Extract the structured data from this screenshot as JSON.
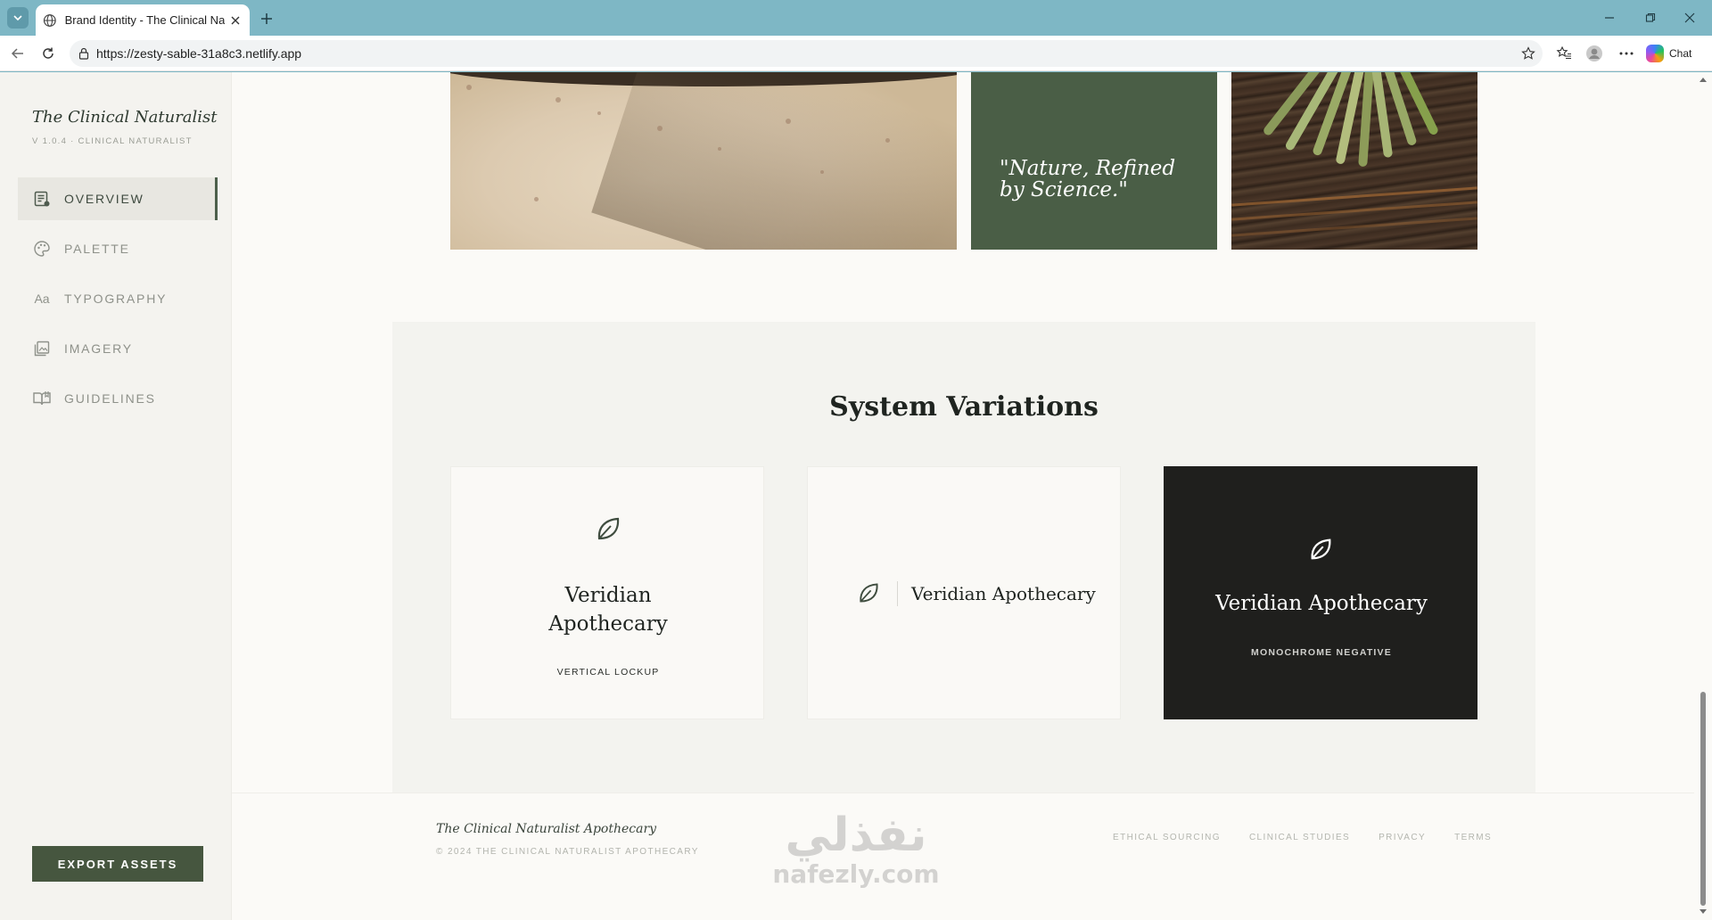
{
  "browser": {
    "tab_title": "Brand Identity - The Clinical Naturalist",
    "url": "https://zesty-sable-31a8c3.netlify.app",
    "chat_label": "Chat"
  },
  "sidebar": {
    "brand_title": "The Clinical Naturalist",
    "version": "V 1.0.4 · CLINICAL NATURALIST",
    "nav": [
      {
        "label": "OVERVIEW",
        "icon": "overview-icon",
        "active": true
      },
      {
        "label": "PALETTE",
        "icon": "palette-icon",
        "active": false
      },
      {
        "label": "TYPOGRAPHY",
        "icon": "typography-icon",
        "glyph": "Aa",
        "active": false
      },
      {
        "label": "IMAGERY",
        "icon": "imagery-icon",
        "active": false
      },
      {
        "label": "GUIDELINES",
        "icon": "guidelines-icon",
        "active": false
      }
    ],
    "export_label": "EXPORT ASSETS"
  },
  "imagery": {
    "quote": "\"Nature, Refined by Science.\""
  },
  "variations": {
    "heading": "System Variations",
    "cards": [
      {
        "name": "Veridian Apothecary",
        "caption": "VERTICAL LOCKUP"
      },
      {
        "name": "Veridian Apothecary",
        "caption": ""
      },
      {
        "name": "Veridian Apothecary",
        "caption": "MONOCHROME NEGATIVE"
      }
    ]
  },
  "footer": {
    "brand": "The Clinical Naturalist Apothecary",
    "copyright": "© 2024 THE CLINICAL NATURALIST APOTHECARY",
    "links": [
      "ETHICAL SOURCING",
      "CLINICAL STUDIES",
      "PRIVACY",
      "TERMS"
    ]
  },
  "watermark": {
    "arabic": "نفذلي",
    "latin": "nafezly.com"
  },
  "colors": {
    "accent": "#46563f",
    "quote_card": "#4a5e46",
    "dark_card": "#1f1f1d",
    "browser_frame": "#7eb7c5"
  }
}
